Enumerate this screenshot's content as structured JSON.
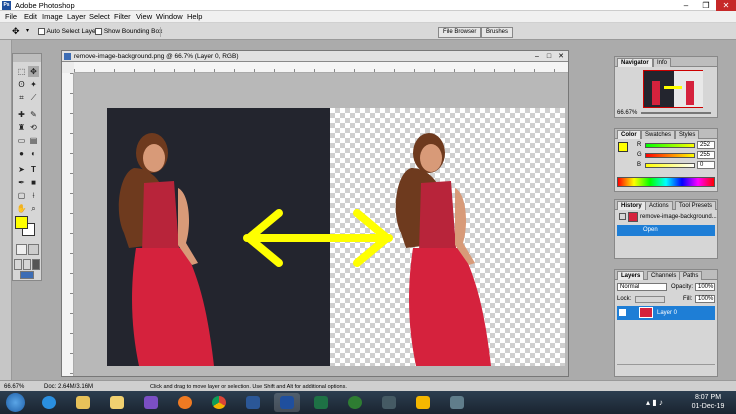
{
  "app": {
    "title": "Adobe Photoshop",
    "window_controls": [
      "–",
      "❐",
      "✕"
    ]
  },
  "menu": [
    "File",
    "Edit",
    "Image",
    "Layer",
    "Select",
    "Filter",
    "View",
    "Window",
    "Help"
  ],
  "options": {
    "auto_select": "Auto Select Layer",
    "bounding": "Show Bounding Box",
    "tabs": [
      "File Browser",
      "Brushes"
    ]
  },
  "document": {
    "title": "remove-image-background.png @ 66.7% (Layer 0, RGB)",
    "controls": [
      "–",
      "□",
      "✕"
    ]
  },
  "navigator": {
    "tabs": [
      "Navigator",
      "Info"
    ],
    "zoom": "66.67%"
  },
  "color": {
    "tabs": [
      "Color",
      "Swatches",
      "Styles"
    ],
    "r_label": "R",
    "g_label": "G",
    "b_label": "B",
    "r": "252",
    "g": "255",
    "b": "0"
  },
  "history": {
    "tabs": [
      "History",
      "Actions",
      "Tool Presets"
    ],
    "snapshot": "remove-image-background...",
    "step": "Open"
  },
  "layers": {
    "tabs": [
      "Layers",
      "Channels",
      "Paths"
    ],
    "blend": "Normal",
    "opacity_label": "Opacity:",
    "opacity": "100%",
    "lock_label": "Lock:",
    "fill_label": "Fill:",
    "fill": "100%",
    "layer_name": "Layer 0"
  },
  "status": {
    "zoom": "66.67%",
    "doc": "Doc: 2.64M/3.16M",
    "hint": "Click and drag to move layer or selection.  Use Shift and Alt for additional options."
  },
  "taskbar": {
    "time": "8:07 PM",
    "date": "01-Dec-19"
  },
  "colors": {
    "foreground": "#ffff00",
    "background": "#ffffff",
    "arrow": "#ffff00",
    "dress": "#d5223d",
    "skin": "#d89a78",
    "hair": "#6e3a1e",
    "taskbar": "#1f2b38"
  },
  "icons": [
    "photoshop-icon",
    "move-tool-icon",
    "marquee-icon",
    "lasso-icon",
    "crop-icon",
    "brush-icon",
    "eraser-icon",
    "text-icon",
    "hand-icon",
    "zoom-icon",
    "double-arrow-icon"
  ]
}
